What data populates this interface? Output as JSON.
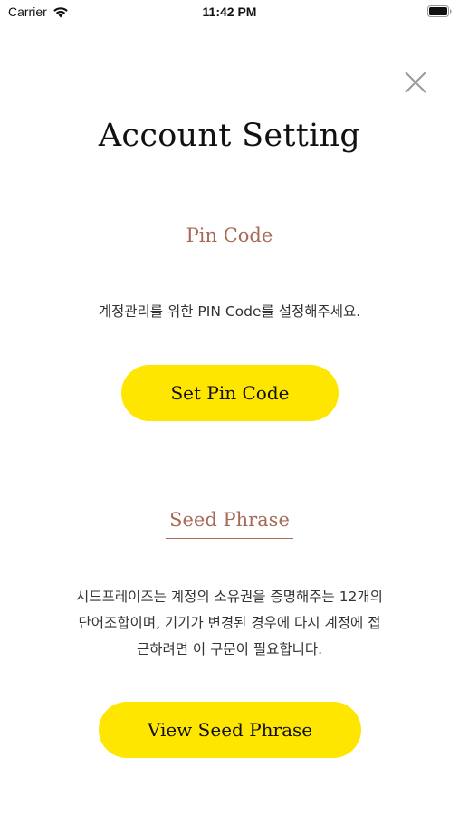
{
  "status_bar": {
    "carrier": "Carrier",
    "time": "11:42 PM",
    "icons": [
      "wifi-icon",
      "battery-icon"
    ]
  },
  "header": {
    "close_icon": "close-icon",
    "title": "Account Setting"
  },
  "pin_section": {
    "heading": "Pin Code",
    "description": "계정관리를 위한 PIN Code를 설정해주세요.",
    "button_label": "Set Pin Code"
  },
  "seed_section": {
    "heading": "Seed Phrase",
    "description_lines": [
      "시드프레이즈는 계정의 소유권을 증명해주는 12개의",
      "단어조합이며, 기기가 변경된 경우에 다시 계정에 접",
      "근하려면 이 구문이 필요합니다."
    ],
    "button_label": "View Seed Phrase"
  },
  "colors": {
    "accent": "#a56a58",
    "button": "#ffe600",
    "text": "#111111"
  }
}
